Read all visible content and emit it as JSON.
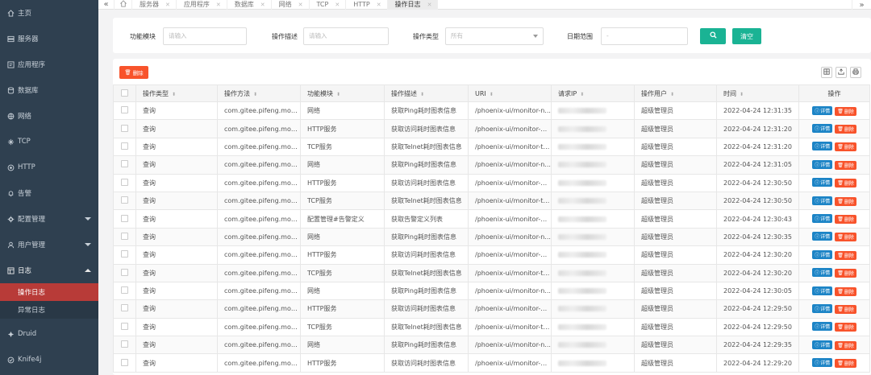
{
  "sidebar": {
    "items": [
      {
        "label": "主页",
        "icon": "home-icon"
      },
      {
        "label": "服务器",
        "icon": "server-icon"
      },
      {
        "label": "应用程序",
        "icon": "app-icon"
      },
      {
        "label": "数据库",
        "icon": "database-icon"
      },
      {
        "label": "网络",
        "icon": "globe-icon"
      },
      {
        "label": "TCP",
        "icon": "tcp-icon"
      },
      {
        "label": "HTTP",
        "icon": "http-icon"
      },
      {
        "label": "告警",
        "icon": "bell-icon"
      },
      {
        "label": "配置管理",
        "icon": "gear-icon"
      },
      {
        "label": "用户管理",
        "icon": "user-icon"
      },
      {
        "label": "日志",
        "icon": "log-icon"
      }
    ],
    "log_sub": [
      "操作日志",
      "异常日志"
    ],
    "bottom_items": [
      {
        "label": "Druid",
        "icon": "druid-icon"
      },
      {
        "label": "Knife4j",
        "icon": "knife4j-icon"
      }
    ]
  },
  "tabs": [
    "服务器",
    "应用程序",
    "数据库",
    "网络",
    "TCP",
    "HTTP",
    "操作日志"
  ],
  "search": {
    "module_label": "功能模块",
    "module_placeholder": "请输入",
    "desc_label": "操作描述",
    "desc_placeholder": "请输入",
    "type_label": "操作类型",
    "type_value": "所有",
    "date_label": "日期范围",
    "date_placeholder": "-",
    "clear_label": "清空"
  },
  "table": {
    "delete_label": "删除",
    "headers": [
      "操作类型",
      "操作方法",
      "功能模块",
      "操作描述",
      "URI",
      "请求IP",
      "操作用户",
      "时间",
      "操作"
    ],
    "detail_label": "详情",
    "row_delete_label": "删除",
    "rows": [
      [
        "查询",
        "com.gitee.pifeng.mon...",
        "网络",
        "获取Ping耗时图表信息",
        "/phoenix-ui/monitor-n...",
        "超级管理员",
        "2022-04-24 12:31:35"
      ],
      [
        "查询",
        "com.gitee.pifeng.mon...",
        "HTTP服务",
        "获取访问耗时图表信息",
        "/phoenix-ui/monitor-ht...",
        "超级管理员",
        "2022-04-24 12:31:20"
      ],
      [
        "查询",
        "com.gitee.pifeng.mon...",
        "TCP服务",
        "获取Telnet耗时图表信息",
        "/phoenix-ui/monitor-tc...",
        "超级管理员",
        "2022-04-24 12:31:20"
      ],
      [
        "查询",
        "com.gitee.pifeng.mon...",
        "网络",
        "获取Ping耗时图表信息",
        "/phoenix-ui/monitor-n...",
        "超级管理员",
        "2022-04-24 12:31:05"
      ],
      [
        "查询",
        "com.gitee.pifeng.mon...",
        "HTTP服务",
        "获取访问耗时图表信息",
        "/phoenix-ui/monitor-ht...",
        "超级管理员",
        "2022-04-24 12:30:50"
      ],
      [
        "查询",
        "com.gitee.pifeng.mon...",
        "TCP服务",
        "获取Telnet耗时图表信息",
        "/phoenix-ui/monitor-tc...",
        "超级管理员",
        "2022-04-24 12:30:50"
      ],
      [
        "查询",
        "com.gitee.pifeng.mon...",
        "配置管理#告警定义",
        "获取告警定义列表",
        "/phoenix-ui/monitor-al...",
        "超级管理员",
        "2022-04-24 12:30:43"
      ],
      [
        "查询",
        "com.gitee.pifeng.mon...",
        "网络",
        "获取Ping耗时图表信息",
        "/phoenix-ui/monitor-n...",
        "超级管理员",
        "2022-04-24 12:30:35"
      ],
      [
        "查询",
        "com.gitee.pifeng.mon...",
        "HTTP服务",
        "获取访问耗时图表信息",
        "/phoenix-ui/monitor-ht...",
        "超级管理员",
        "2022-04-24 12:30:20"
      ],
      [
        "查询",
        "com.gitee.pifeng.mon...",
        "TCP服务",
        "获取Telnet耗时图表信息",
        "/phoenix-ui/monitor-tc...",
        "超级管理员",
        "2022-04-24 12:30:20"
      ],
      [
        "查询",
        "com.gitee.pifeng.mon...",
        "网络",
        "获取Ping耗时图表信息",
        "/phoenix-ui/monitor-n...",
        "超级管理员",
        "2022-04-24 12:30:05"
      ],
      [
        "查询",
        "com.gitee.pifeng.mon...",
        "HTTP服务",
        "获取访问耗时图表信息",
        "/phoenix-ui/monitor-ht...",
        "超级管理员",
        "2022-04-24 12:29:50"
      ],
      [
        "查询",
        "com.gitee.pifeng.mon...",
        "TCP服务",
        "获取Telnet耗时图表信息",
        "/phoenix-ui/monitor-tc...",
        "超级管理员",
        "2022-04-24 12:29:50"
      ],
      [
        "查询",
        "com.gitee.pifeng.mon...",
        "网络",
        "获取Ping耗时图表信息",
        "/phoenix-ui/monitor-n...",
        "超级管理员",
        "2022-04-24 12:29:35"
      ],
      [
        "查询",
        "com.gitee.pifeng.mon...",
        "HTTP服务",
        "获取访问耗时图表信息",
        "/phoenix-ui/monitor-ht...",
        "超级管理员",
        "2022-04-24 12:29:20"
      ]
    ]
  },
  "colors": {
    "sidebar_bg": "#2f4050",
    "active_red": "#b83b38",
    "primary_green": "#1ab394",
    "detail_blue": "#1c84c6",
    "delete_orange": "#f8532b"
  }
}
